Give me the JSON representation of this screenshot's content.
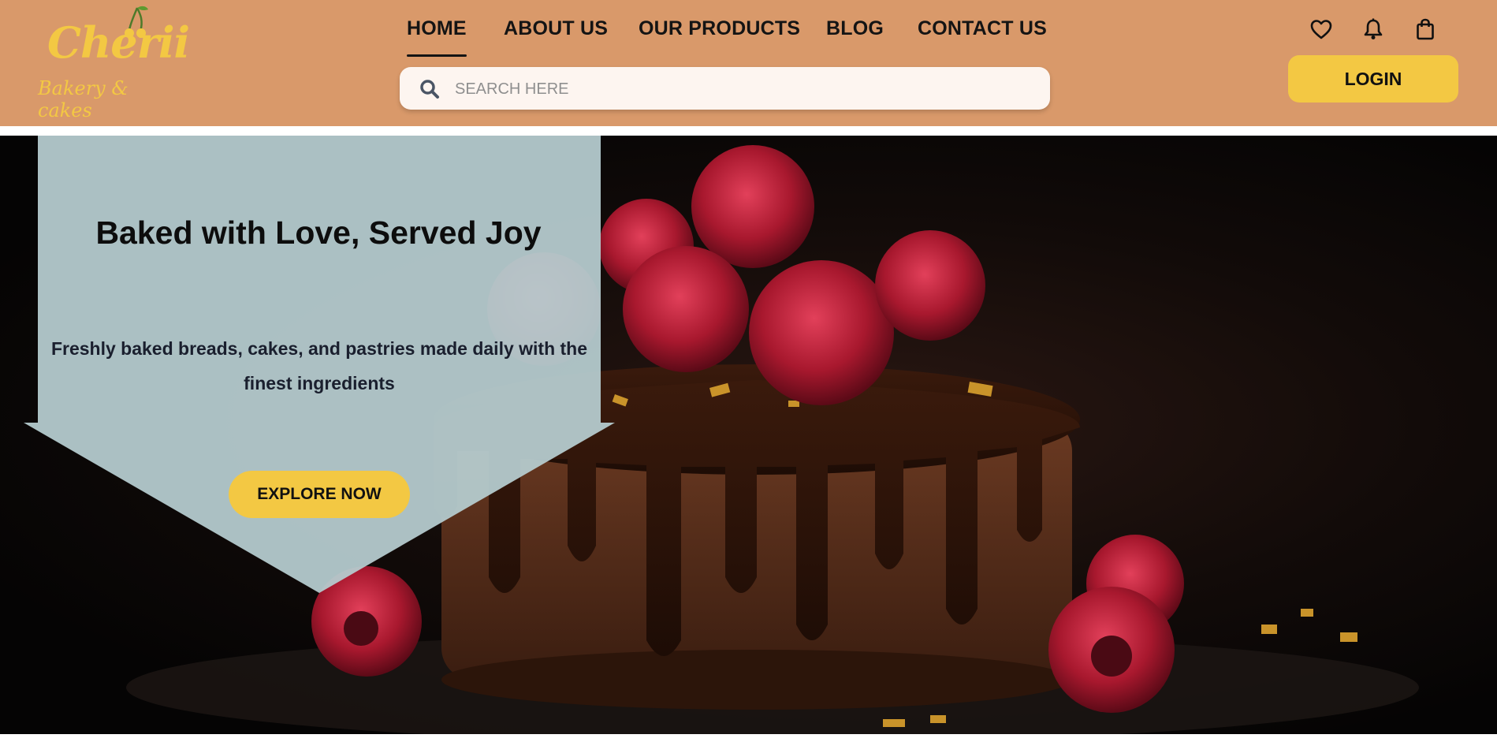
{
  "brand": {
    "name": "Cherii",
    "tagline": "Bakery & cakes",
    "color": "#f3c843"
  },
  "nav": {
    "items": [
      {
        "label": "HOME",
        "active": true
      },
      {
        "label": "ABOUT US",
        "active": false
      },
      {
        "label": "OUR PRODUCTS",
        "active": false
      },
      {
        "label": "BLOG",
        "active": false
      },
      {
        "label": "CONTACT US",
        "active": false
      }
    ]
  },
  "search": {
    "placeholder": "SEARCH HERE",
    "value": "",
    "icon": "search-icon"
  },
  "header_icons": [
    "heart-icon",
    "bell-icon",
    "shopping-bag-icon"
  ],
  "login": {
    "label": "LOGIN"
  },
  "hero": {
    "title": "Baked with Love, Served Joy",
    "subtitle": "Freshly baked breads, cakes, and pastries made daily with the finest ingredients",
    "cta_label": "EXPLORE NOW"
  },
  "colors": {
    "header_bg": "#d9996a",
    "accent": "#f3c843",
    "panel": "#b6cccf"
  }
}
